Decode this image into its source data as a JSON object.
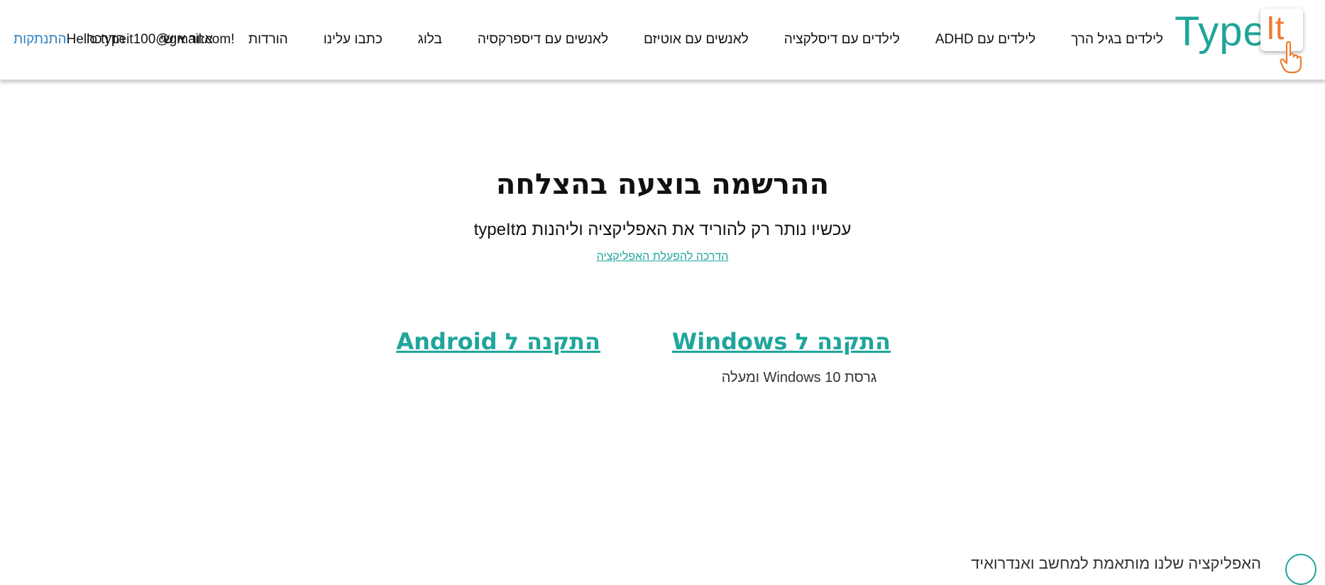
{
  "header": {
    "logo": {
      "type_text": "Type",
      "key_text": "It"
    },
    "nav": [
      {
        "label": "לילדים בגיל הרך"
      },
      {
        "label": "לילדים עם ADHD"
      },
      {
        "label": "לילדים עם דיסלקציה"
      },
      {
        "label": "לאנשים עם אוטיזם"
      },
      {
        "label": "לאנשים עם דיספרקסיה"
      },
      {
        "label": "בלוג"
      },
      {
        "label": "כתבו עלינו"
      },
      {
        "label": "הורדות"
      },
      {
        "label": "אזור אישי"
      },
      {
        "label": "הדרכה"
      }
    ],
    "user": {
      "greeting": "Hello typeit100@gmail.com!",
      "logout_label": "התנתקות"
    }
  },
  "main": {
    "title": "ההרשמה בוצעה בהצלחה",
    "subtitle": "עכשיו נותר רק להוריד את האפליקציה וליהנות מtypeIt",
    "guide_link": "הדרכה להפעלת האפליקציה",
    "install_windows": "התקנה ל Windows",
    "windows_note": "גרסת Windows 10 ומעלה",
    "install_android": "התקנה ל Android"
  },
  "footer_peek": {
    "text": "האפליקציה שלנו מותאמת למחשב ואנדרואיד"
  },
  "colors": {
    "accent": "#1fa59b",
    "logo_orange": "#ef7a2f",
    "logout_link": "#2a7fc0"
  }
}
